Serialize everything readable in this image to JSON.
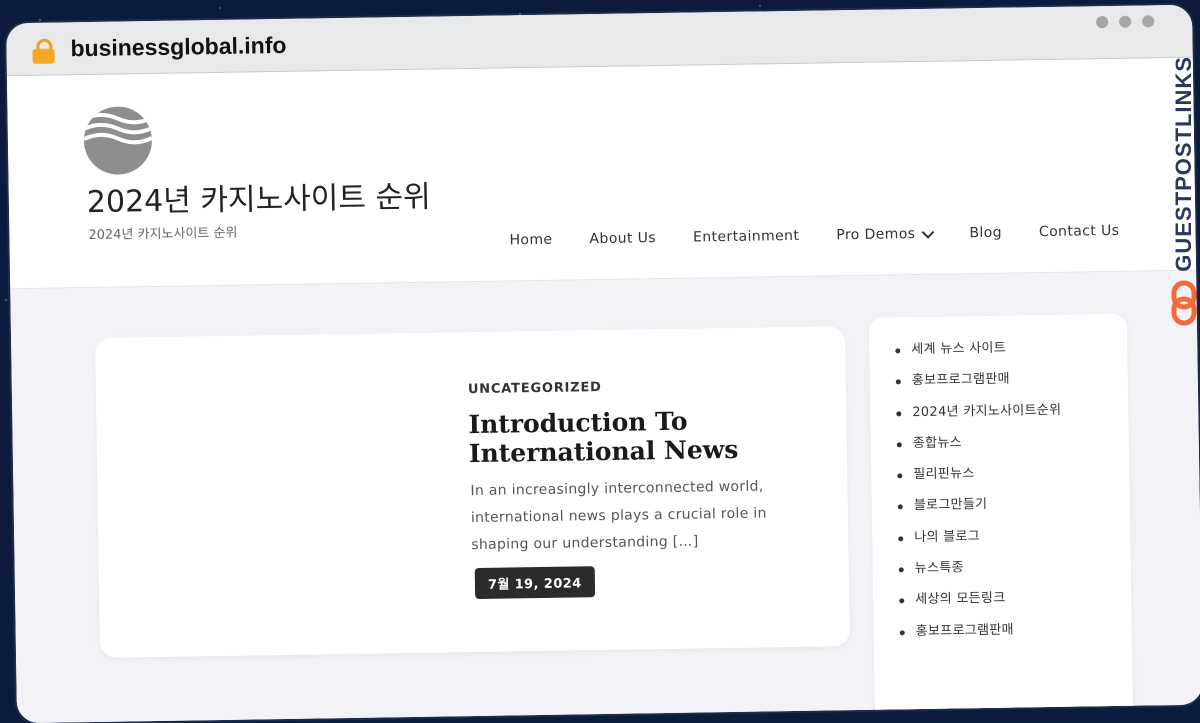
{
  "browser": {
    "url": "businessglobal.info"
  },
  "site": {
    "title": "2024년 카지노사이트 순위",
    "tagline": "2024년 카지노사이트 순위"
  },
  "nav": {
    "items": [
      {
        "label": "Home"
      },
      {
        "label": "About Us"
      },
      {
        "label": "Entertainment"
      },
      {
        "label": "Pro Demos",
        "has_dropdown": true
      },
      {
        "label": "Blog"
      },
      {
        "label": "Contact Us"
      }
    ]
  },
  "post": {
    "category": "UNCATEGORIZED",
    "title": "Introduction To International News",
    "excerpt": "In an increasingly interconnected world, international news plays a crucial role in shaping our understanding […]",
    "date": "7월 19, 2024"
  },
  "sidebar": {
    "items": [
      "세계 뉴스 사이트",
      "홍보프로그램판매",
      "2024년 카지노사이트순위",
      "종합뉴스",
      "필리핀뉴스",
      "블로그만들기",
      "나의 블로그",
      "뉴스특종",
      "세상의 모든링크",
      "홍보프로그램판매"
    ]
  },
  "brand": {
    "name": "GUESTPOSTLINKS",
    "text_color": "#2a3a5c",
    "icon_color": "#f26a3a",
    "icon": "link-icon"
  },
  "colors": {
    "lock": "#f7a825",
    "date_badge": "#2b2b2b",
    "page_bg": "#f3f3f7"
  }
}
